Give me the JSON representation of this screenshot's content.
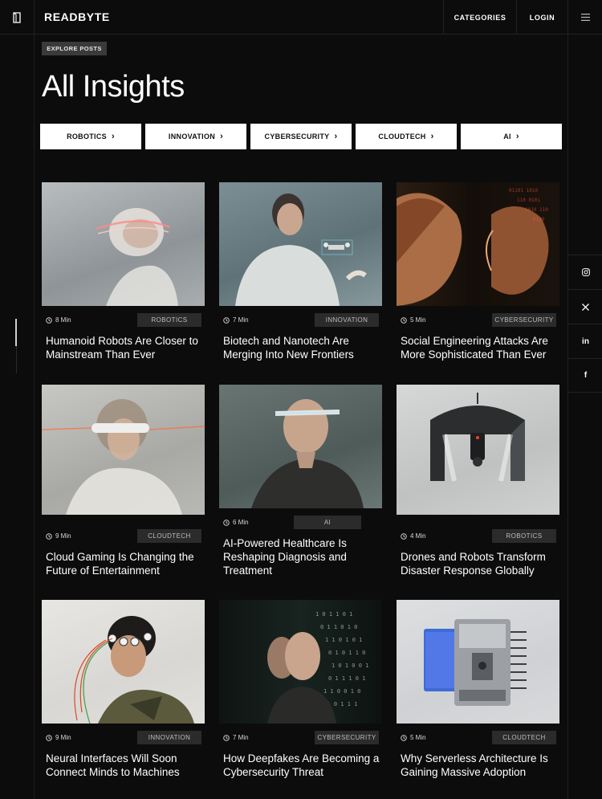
{
  "header": {
    "brand": "READBYTE",
    "nav": {
      "categories": "CATEGORIES",
      "login": "LOGIN"
    }
  },
  "hero": {
    "explore_label": "EXPLORE POSTS",
    "title": "All Insights"
  },
  "categories": [
    {
      "label": "ROBOTICS"
    },
    {
      "label": "INNOVATION"
    },
    {
      "label": "CYBERSECURITY"
    },
    {
      "label": "CLOUDTECH"
    },
    {
      "label": "AI"
    }
  ],
  "social": [
    {
      "name": "instagram-icon",
      "glyph": "◎"
    },
    {
      "name": "x-icon",
      "glyph": "𝕏"
    },
    {
      "name": "linkedin-icon",
      "glyph": "in"
    },
    {
      "name": "facebook-icon",
      "glyph": "f"
    }
  ],
  "posts": [
    {
      "read_time": "8 Min",
      "tag": "ROBOTICS",
      "title": "Humanoid Robots Are Closer to Mainstream Than Ever"
    },
    {
      "read_time": "7 Min",
      "tag": "INNOVATION",
      "title": "Biotech and Nanotech Are Merging Into New Frontiers"
    },
    {
      "read_time": "5 Min",
      "tag": "CYBERSECURITY",
      "title": "Social Engineering Attacks Are More Sophisticated Than Ever"
    },
    {
      "read_time": "9 Min",
      "tag": "CLOUDTECH",
      "title": "Cloud Gaming Is Changing the Future of Entertainment"
    },
    {
      "read_time": "6 Min",
      "tag": "AI",
      "title": "AI-Powered Healthcare Is Reshaping Diagnosis and Treatment"
    },
    {
      "read_time": "4 Min",
      "tag": "ROBOTICS",
      "title": "Drones and Robots Transform Disaster Response Globally"
    },
    {
      "read_time": "9 Min",
      "tag": "INNOVATION",
      "title": "Neural Interfaces Will Soon Connect Minds to Machines"
    },
    {
      "read_time": "7 Min",
      "tag": "CYBERSECURITY",
      "title": "How Deepfakes Are Becoming a Cybersecurity Threat"
    },
    {
      "read_time": "5 Min",
      "tag": "CLOUDTECH",
      "title": "Why Serverless Architecture Is Gaining Massive Adoption"
    }
  ]
}
